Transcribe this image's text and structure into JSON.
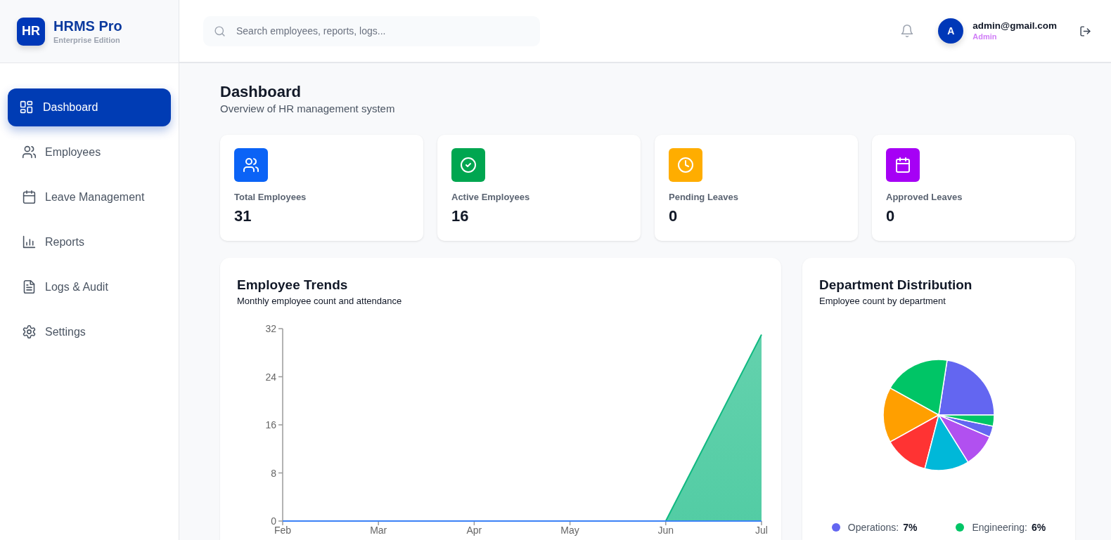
{
  "brand": {
    "logo": "HR",
    "name": "HRMS Pro",
    "edition": "Enterprise Edition"
  },
  "sidebar": {
    "items": [
      {
        "label": "Dashboard",
        "selected": true
      },
      {
        "label": "Employees",
        "selected": false
      },
      {
        "label": "Leave Management",
        "selected": false
      },
      {
        "label": "Reports",
        "selected": false
      },
      {
        "label": "Logs & Audit",
        "selected": false
      },
      {
        "label": "Settings",
        "selected": false
      }
    ]
  },
  "topbar": {
    "search": {
      "placeholder": "Search employees, reports, logs..."
    },
    "user": {
      "avatar": "A",
      "email": "admin@gmail.com",
      "role": "Admin"
    }
  },
  "page": {
    "title": "Dashboard",
    "subtitle": "Overview of HR management system"
  },
  "stats": [
    {
      "label": "Total Employees",
      "value": "31",
      "color": "#0b63f6"
    },
    {
      "label": "Active Employees",
      "value": "16",
      "color": "#00a650"
    },
    {
      "label": "Pending Leaves",
      "value": "0",
      "color": "#ffad00"
    },
    {
      "label": "Approved Leaves",
      "value": "0",
      "color": "#a600f5"
    }
  ],
  "trends": {
    "title": "Employee Trends",
    "subtitle": "Monthly employee count and attendance",
    "chart_data": {
      "type": "area",
      "categories": [
        "Feb",
        "Mar",
        "Apr",
        "May",
        "Jun",
        "Jul"
      ],
      "series": [
        {
          "color": "#10b981",
          "values": [
            null,
            null,
            null,
            null,
            0,
            31
          ]
        },
        {
          "color": "#3b82f6",
          "values": [
            0,
            0,
            0,
            0,
            0,
            0
          ]
        }
      ],
      "ylim": [
        0,
        32
      ],
      "yticks": [
        0,
        8,
        16,
        24,
        32
      ]
    }
  },
  "departments": {
    "title": "Department Distribution",
    "subtitle": "Employee count by department",
    "legend": [
      {
        "label": "Operations:",
        "value": "7%",
        "color": "#6366f1"
      },
      {
        "label": "Engineering:",
        "value": "6%",
        "color": "#00c566"
      }
    ]
  }
}
